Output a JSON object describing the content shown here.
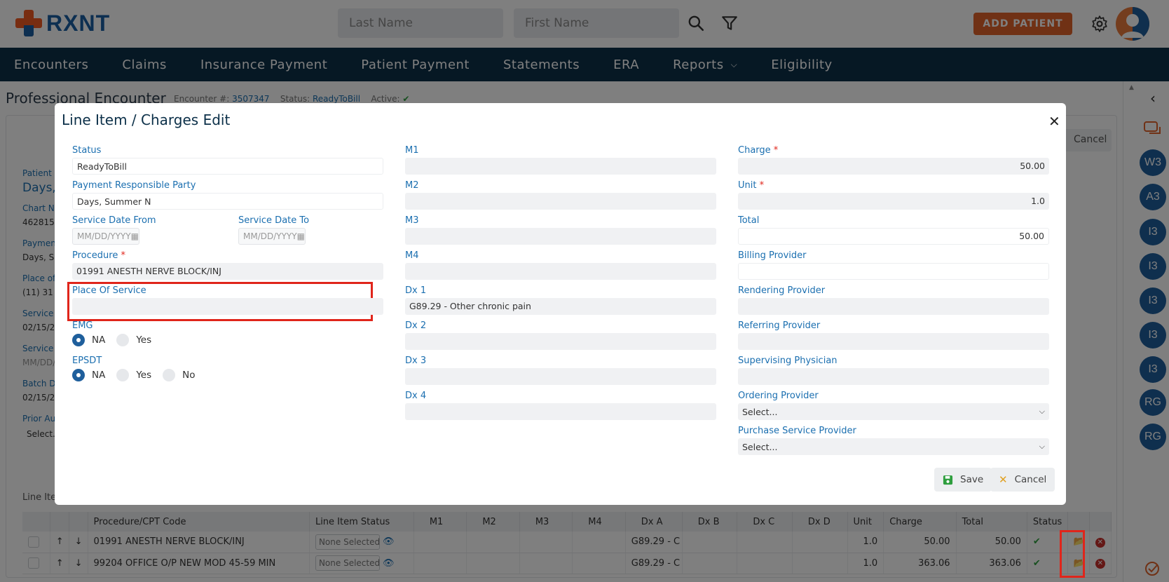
{
  "header": {
    "logo_text": "RXNT",
    "last_name_placeholder": "Last Name",
    "first_name_placeholder": "First Name",
    "add_patient_label": "ADD PATIENT"
  },
  "nav": {
    "items": [
      "Encounters",
      "Claims",
      "Insurance Payment",
      "Patient Payment",
      "Statements",
      "ERA",
      "Reports",
      "Eligibility"
    ]
  },
  "page": {
    "title": "Professional Encounter",
    "encounter_label": "Encounter #:",
    "encounter_value": "3507347",
    "status_label": "Status:",
    "status_value": "ReadyToBill",
    "active_label": "Active:",
    "cancel_label": "Cancel",
    "fragments": {
      "patient": "Patient",
      "patient_name": "Days,",
      "chart": "Chart N",
      "chart_val": "462815",
      "payment": "Paymen",
      "payment_val": "Days, S",
      "place": "Place of",
      "place_val": "(11) 31",
      "service": "Service",
      "service_val": "02/15/2",
      "service2": "Service",
      "service2_val": "MM/DD/",
      "batch": "Batch D",
      "batch_val": "02/15/2",
      "prior": "Prior Au",
      "prior_val": "Select..."
    },
    "line_items_title": "Line Ite",
    "table": {
      "headers": [
        "Procedure/CPT Code",
        "Line Item Status",
        "M1",
        "M2",
        "M3",
        "M4",
        "Dx A",
        "Dx B",
        "Dx C",
        "Dx D",
        "Unit",
        "Charge",
        "Total",
        "Status"
      ],
      "rows": [
        {
          "code": "01991 ANESTH NERVE BLOCK/INJ",
          "status": "None Selected",
          "dxa": "G89.29 - C",
          "unit": "1.0",
          "charge": "50.00",
          "total": "50.00"
        },
        {
          "code": "99204 OFFICE O/P NEW MOD 45-59 MIN",
          "status": "None Selected",
          "dxa": "G89.29 - C",
          "unit": "1.0",
          "charge": "363.06",
          "total": "363.06"
        }
      ]
    }
  },
  "sidebar": {
    "bubbles": [
      "W3",
      "A3",
      "I3",
      "I3",
      "I3",
      "I3",
      "I3",
      "RG",
      "RG"
    ]
  },
  "modal": {
    "title": "Line Item / Charges Edit",
    "status_label": "Status",
    "status_value": "ReadyToBill",
    "prp_label": "Payment Responsible Party",
    "prp_value": "Days, Summer N",
    "sdf_label": "Service Date From",
    "sdt_label": "Service Date To",
    "date_placeholder": "MM/DD/YYYY",
    "procedure_label": "Procedure",
    "procedure_value": "01991 ANESTH NERVE BLOCK/INJ",
    "pos_label": "Place Of Service",
    "pos_value": "",
    "emg_label": "EMG",
    "emg_options": [
      "NA",
      "Yes"
    ],
    "epsdt_label": "EPSDT",
    "epsdt_options": [
      "NA",
      "Yes",
      "No"
    ],
    "m1_label": "M1",
    "m2_label": "M2",
    "m3_label": "M3",
    "m4_label": "M4",
    "dx1_label": "Dx 1",
    "dx1_value": "G89.29 - Other chronic pain",
    "dx2_label": "Dx 2",
    "dx3_label": "Dx 3",
    "dx4_label": "Dx 4",
    "charge_label": "Charge",
    "charge_value": "50.00",
    "unit_label": "Unit",
    "unit_value": "1.0",
    "total_label": "Total",
    "total_value": "50.00",
    "billing_label": "Billing Provider",
    "rendering_label": "Rendering Provider",
    "referring_label": "Referring Provider",
    "supervising_label": "Supervising Physician",
    "ordering_label": "Ordering Provider",
    "ordering_value": "Select...",
    "purchase_label": "Purchase Service Provider",
    "purchase_value": "Select...",
    "required_mark": "*",
    "save_label": "Save",
    "cancel_label": "Cancel"
  }
}
